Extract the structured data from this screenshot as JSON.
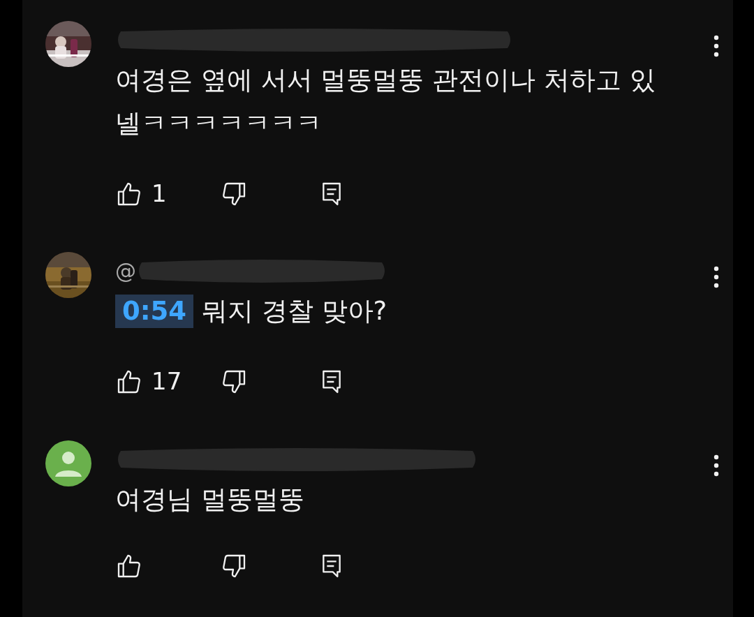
{
  "comments": [
    {
      "avatar": {
        "kind": "picture"
      },
      "lines": [
        "여경은 옆에 서서 멀뚱멀뚱 관전이나 처하고 있",
        "넬ㅋㅋㅋㅋㅋㅋㅋ"
      ],
      "likes": "1"
    },
    {
      "avatar": {
        "kind": "picture"
      },
      "handle": "@",
      "timestamp": "0:54",
      "lines": [
        "뭐지 경찰 맞아?"
      ],
      "likes": "17"
    },
    {
      "avatar": {
        "kind": "default"
      },
      "lines": [
        "여경님 멀뚱멀뚱"
      ]
    }
  ]
}
